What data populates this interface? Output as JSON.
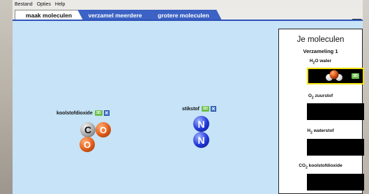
{
  "menu": {
    "items": [
      "Bestand",
      "Opties",
      "Help"
    ]
  },
  "tabs": [
    "maak moleculen",
    "verzamel meerdere",
    "grotere moleculen"
  ],
  "playarea": {
    "molecules": [
      {
        "name": "koolstofdioxide",
        "badge_3d": "3D",
        "atoms": [
          "C",
          "O",
          "O"
        ]
      },
      {
        "name": "stikstof",
        "badge_3d": "3D",
        "atoms": [
          "N",
          "N"
        ]
      }
    ]
  },
  "panel": {
    "title": "Je moleculen",
    "subtitle": "Verzameling 1",
    "slots": [
      {
        "formula_main": "H",
        "formula_sub": "2",
        "formula_rest": "O",
        "name": "water",
        "filled": true,
        "badge": "3D"
      },
      {
        "formula_main": "O",
        "formula_sub": "2",
        "formula_rest": "",
        "name": "zuurstof",
        "filled": false
      },
      {
        "formula_main": "H",
        "formula_sub": "2",
        "formula_rest": "",
        "name": "waterstof",
        "filled": false
      },
      {
        "formula_main": "CO",
        "formula_sub": "2",
        "formula_rest": "",
        "name": "koolstofdioxide",
        "filled": false
      }
    ]
  },
  "colors": {
    "playarea_bg": "#c6e3f7",
    "tab_active_bg": "#ffffff",
    "tab_inactive_bg": "#3b62c4",
    "slot_highlight": "#f2e200"
  }
}
